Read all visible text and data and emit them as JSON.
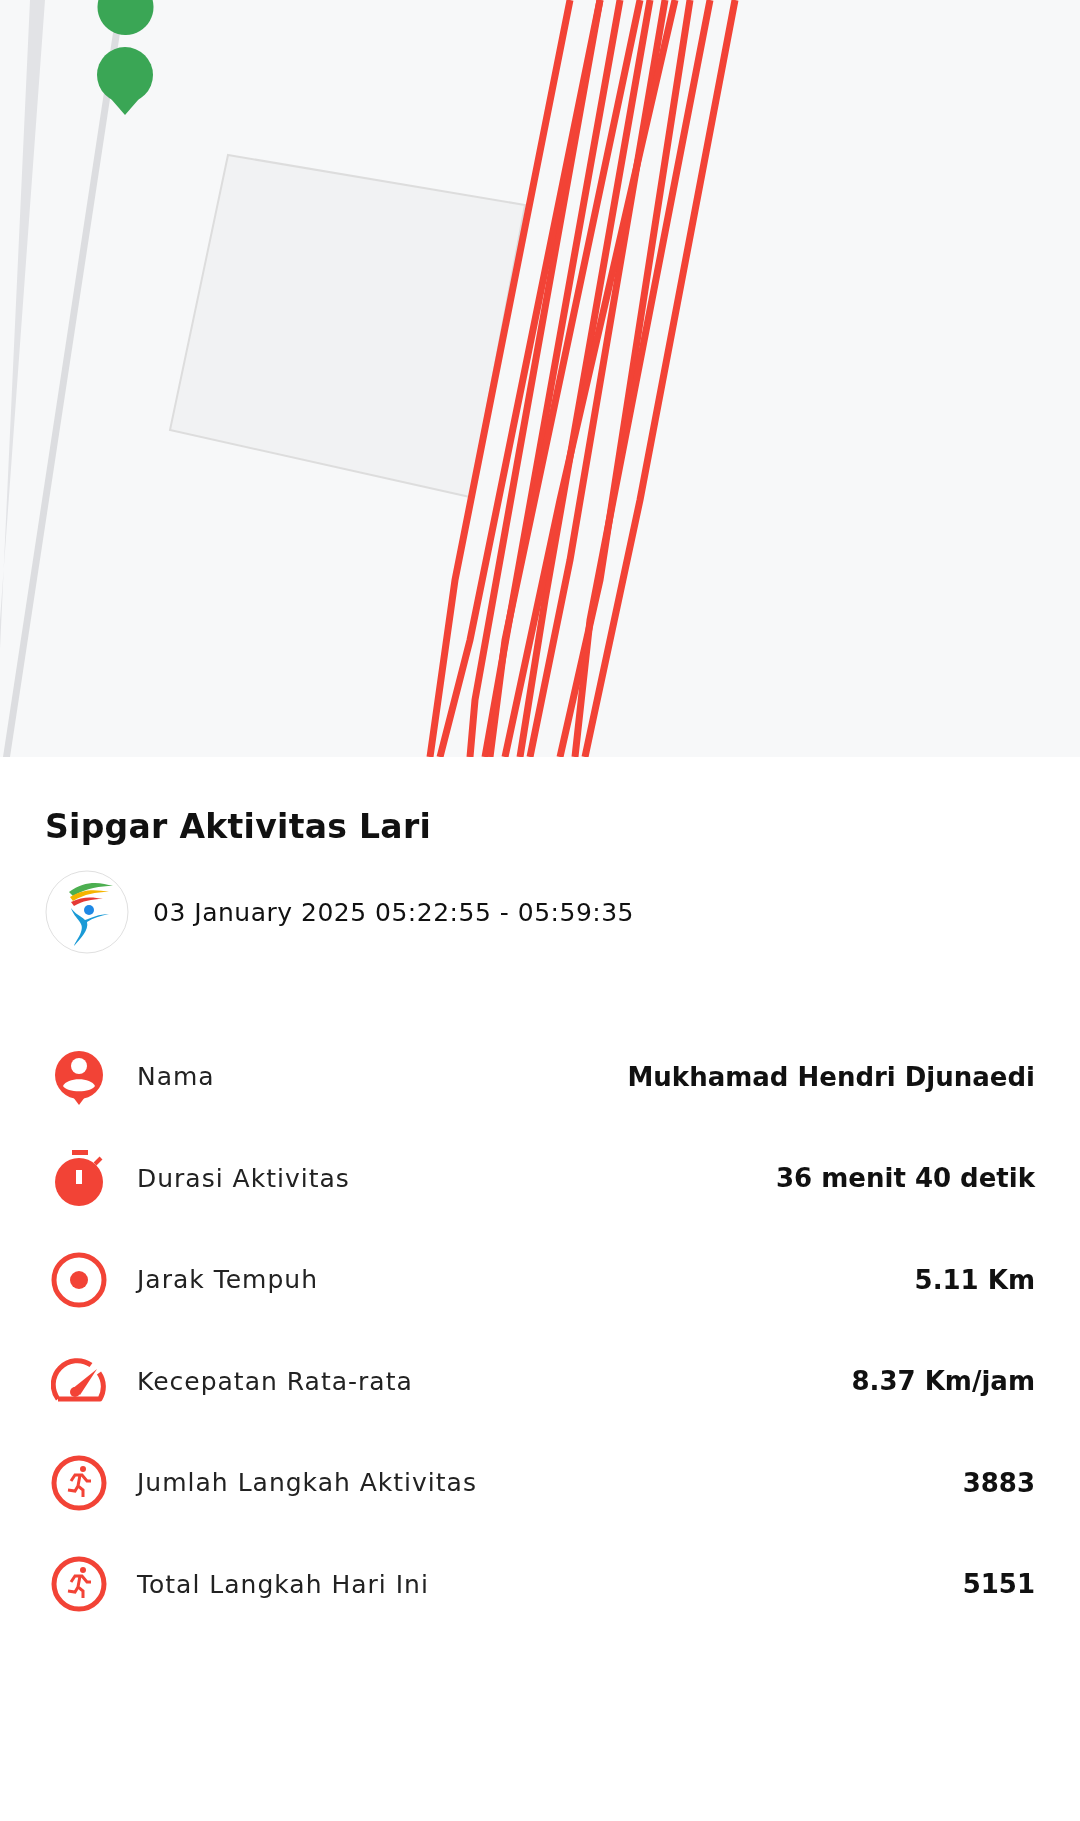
{
  "title": "Sipgar Aktivitas Lari",
  "session": {
    "time_range": "03 January 2025 05:22:55 - 05:59:35"
  },
  "stats": [
    {
      "kind": "person",
      "label": "Nama",
      "value": "Mukhamad Hendri Djunaedi"
    },
    {
      "kind": "timer",
      "label": "Durasi Aktivitas",
      "value": "36 menit 40 detik"
    },
    {
      "kind": "target",
      "label": "Jarak Tempuh",
      "value": "5.11 Km"
    },
    {
      "kind": "speed",
      "label": "Kecepatan Rata-rata",
      "value": "8.37 Km/jam"
    },
    {
      "kind": "run",
      "label": "Jumlah Langkah Aktivitas",
      "value": "3883"
    },
    {
      "kind": "run",
      "label": "Total Langkah Hari Ini",
      "value": "5151"
    }
  ]
}
